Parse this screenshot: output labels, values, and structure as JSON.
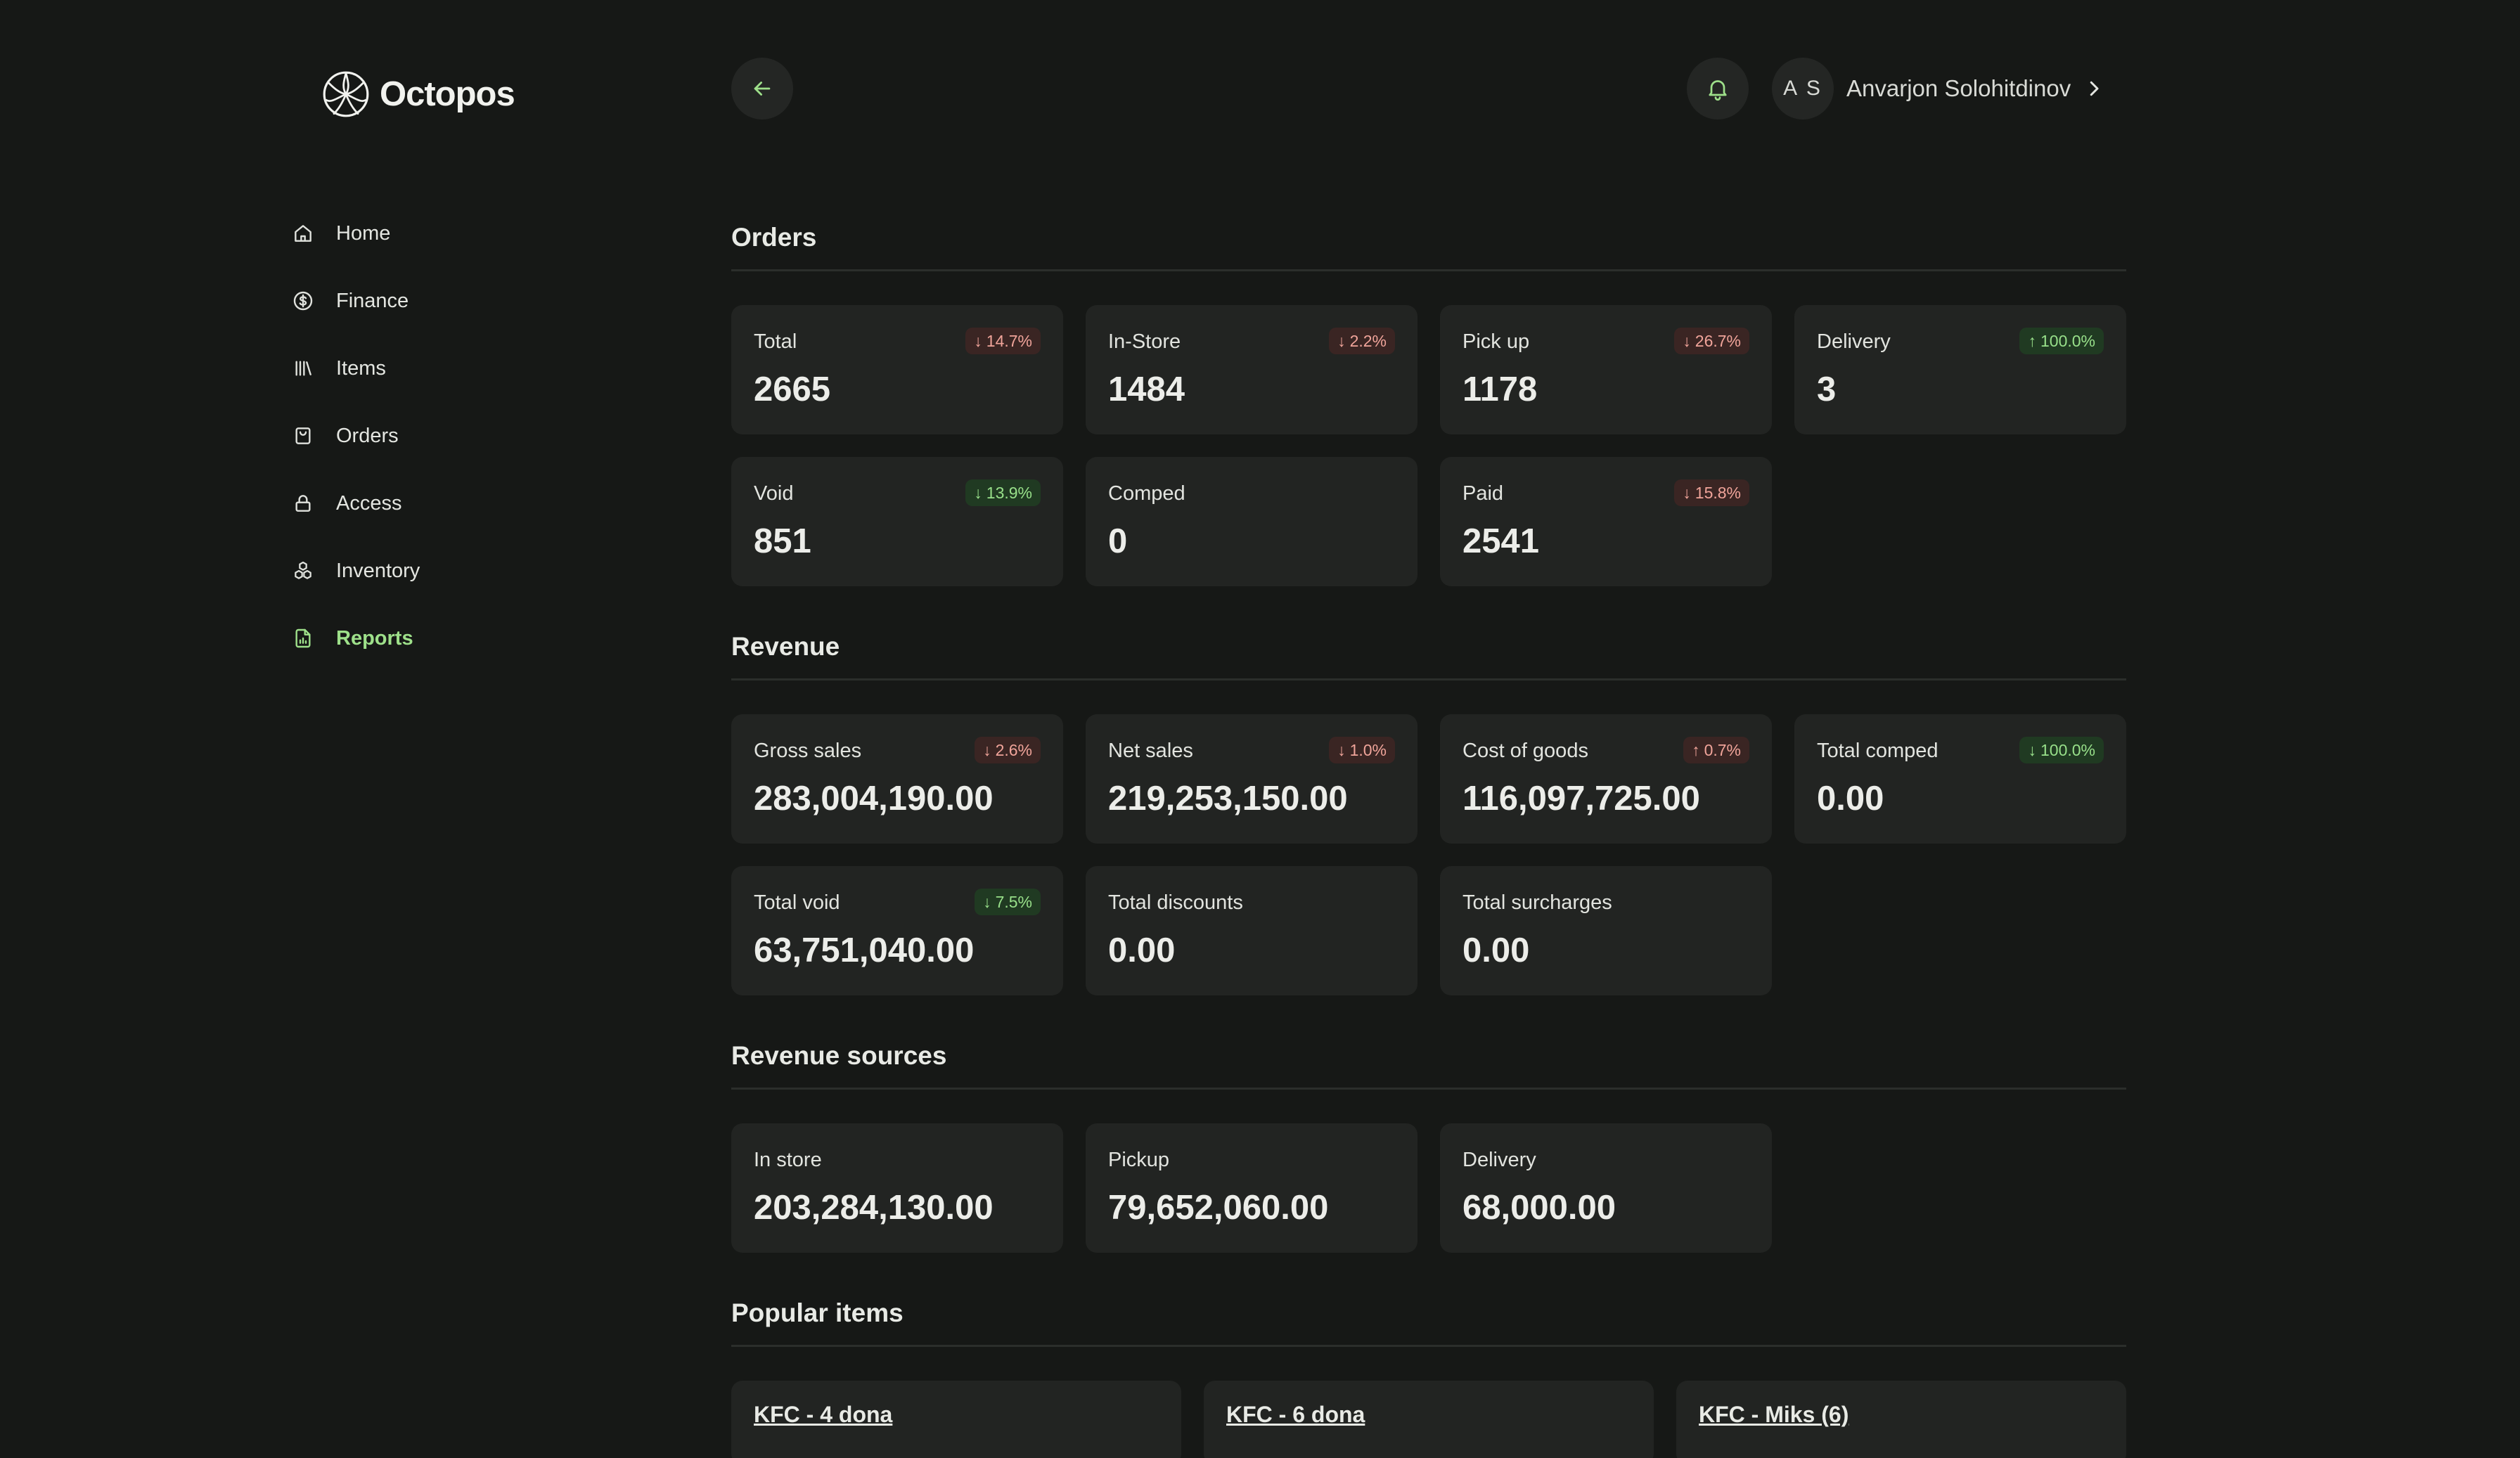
{
  "app": {
    "name": "Octopos"
  },
  "sidebar": {
    "items": [
      {
        "label": "Home",
        "icon": "home-icon",
        "active": false
      },
      {
        "label": "Finance",
        "icon": "dollar-circle-icon",
        "active": false
      },
      {
        "label": "Items",
        "icon": "library-icon",
        "active": false
      },
      {
        "label": "Orders",
        "icon": "shopping-bag-icon",
        "active": false
      },
      {
        "label": "Access",
        "icon": "lock-icon",
        "active": false
      },
      {
        "label": "Inventory",
        "icon": "boxes-icon",
        "active": false
      },
      {
        "label": "Reports",
        "icon": "report-file-icon",
        "active": true
      }
    ]
  },
  "header": {
    "back_icon": "arrow-left-icon",
    "bell_icon": "bell-icon",
    "user": {
      "initials": "A S",
      "name": "Anvarjon Solohitdinov"
    }
  },
  "colors": {
    "background": "#161816",
    "card": "#222422",
    "accent_green": "#9ee08a",
    "negative": "#f0a49a"
  },
  "sections": {
    "orders": {
      "title": "Orders",
      "cards": [
        {
          "label": "Total",
          "value": "2665",
          "badge": "14.7%",
          "direction": "down",
          "tone": "bad"
        },
        {
          "label": "In-Store",
          "value": "1484",
          "badge": "2.2%",
          "direction": "down",
          "tone": "bad"
        },
        {
          "label": "Pick up",
          "value": "1178",
          "badge": "26.7%",
          "direction": "down",
          "tone": "bad"
        },
        {
          "label": "Delivery",
          "value": "3",
          "badge": "100.0%",
          "direction": "up",
          "tone": "good"
        },
        {
          "label": "Void",
          "value": "851",
          "badge": "13.9%",
          "direction": "down",
          "tone": "good"
        },
        {
          "label": "Comped",
          "value": "0",
          "badge": "",
          "direction": "",
          "tone": ""
        },
        {
          "label": "Paid",
          "value": "2541",
          "badge": "15.8%",
          "direction": "down",
          "tone": "bad"
        }
      ]
    },
    "revenue": {
      "title": "Revenue",
      "cards": [
        {
          "label": "Gross sales",
          "value": "283,004,190.00",
          "badge": "2.6%",
          "direction": "down",
          "tone": "bad"
        },
        {
          "label": "Net sales",
          "value": "219,253,150.00",
          "badge": "1.0%",
          "direction": "down",
          "tone": "bad"
        },
        {
          "label": "Cost of goods",
          "value": "116,097,725.00",
          "badge": "0.7%",
          "direction": "up",
          "tone": "bad"
        },
        {
          "label": "Total comped",
          "value": "0.00",
          "badge": "100.0%",
          "direction": "down",
          "tone": "good"
        },
        {
          "label": "Total void",
          "value": "63,751,040.00",
          "badge": "7.5%",
          "direction": "down",
          "tone": "good"
        },
        {
          "label": "Total discounts",
          "value": "0.00",
          "badge": "",
          "direction": "",
          "tone": ""
        },
        {
          "label": "Total surcharges",
          "value": "0.00",
          "badge": "",
          "direction": "",
          "tone": ""
        }
      ]
    },
    "revenue_sources": {
      "title": "Revenue sources",
      "cards": [
        {
          "label": "In store",
          "value": "203,284,130.00"
        },
        {
          "label": "Pickup",
          "value": "79,652,060.00"
        },
        {
          "label": "Delivery",
          "value": "68,000.00"
        }
      ]
    },
    "popular_items": {
      "title": "Popular items",
      "items": [
        "KFC - 4 dona",
        "KFC - 6 dona",
        "KFC - Miks (6)"
      ]
    }
  }
}
